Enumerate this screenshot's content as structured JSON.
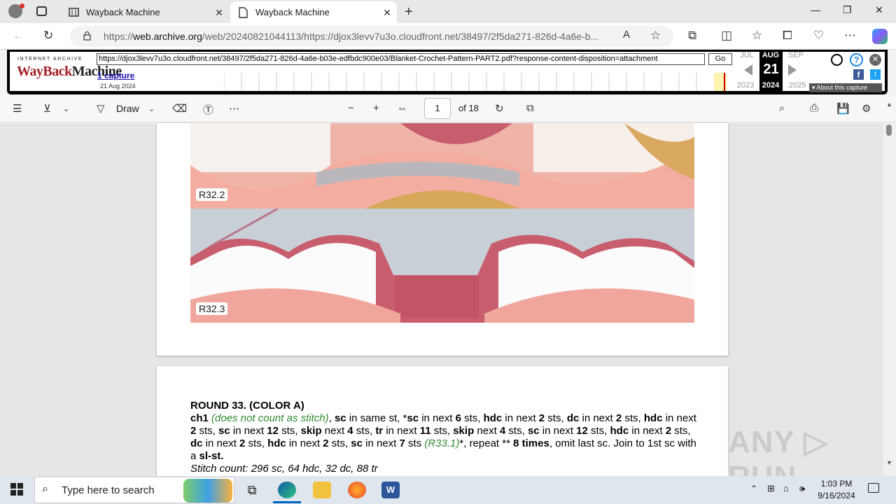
{
  "browser": {
    "tabs": [
      {
        "label": "Wayback Machine"
      },
      {
        "label": "Wayback Machine"
      }
    ],
    "url_prefix": "https://",
    "url_host": "web.archive.org",
    "url_rest": "/web/20240821044113/https://djox3levv7u3o.cloudfront.net/38497/2f5da271-826d-4a6e-b...",
    "new_tab_symbol": "+",
    "minimize_symbol": "—",
    "maximize_symbol": "❐",
    "close_symbol": "✕"
  },
  "wayback": {
    "logo_top": "INTERNET ARCHIVE",
    "logo_way": "Way",
    "logo_back": "Back",
    "logo_machine": "Machine",
    "url_field": "https://djox3levv7u3o.cloudfront.net/38497/2f5da271-826d-4a6e-b03e-edfbdc900e03/Blanket-Crochet-Pattern-PART2.pdf?response-content-disposition=attachment",
    "go_label": "Go",
    "captures_label": "1 capture",
    "capture_date": "21 Aug 2024",
    "prev_month": "JUL",
    "cur_month": "AUG",
    "next_month": "SEP",
    "day": "21",
    "prev_year": "2023",
    "cur_year": "2024",
    "next_year": "2025",
    "about_label": "About this capture"
  },
  "pdf_toolbar": {
    "draw_label": "Draw",
    "page_number": "1",
    "page_total": "of 18"
  },
  "document": {
    "photo1_label": "R32.2",
    "photo2_label": "R32.3",
    "round_heading": "ROUND 33. (COLOR A)",
    "line1_a": "ch1",
    "line1_b": "(does not count as stitch)",
    "line1_c": ", ",
    "p_sc": "sc",
    "t1": " in same st, *",
    "t2": " in next ",
    "n6": "6",
    "t3": " sts, ",
    "p_hdc": "hdc",
    "n2": "2",
    "p_dc": "dc",
    "n12": "12",
    "p_skip": "skip",
    "t_next": " next ",
    "n4": "4",
    "p_tr": "tr",
    "n11": "11",
    "n7": "7",
    "r331": "(R33.1)",
    "t_rep": "*, repeat ** ",
    "n8times": "8 times",
    "t_omit": ", omit last",
    "t_sc": "sc. Join to 1st sc with a ",
    "p_slst": "sl-st.",
    "stitch_count": "Stitch count: 296 sc, 64 hdc, 32 dc, 88 tr"
  },
  "watermark": "ANY ▷ RUN",
  "taskbar": {
    "search_placeholder": "Type here to search",
    "time": "1:03 PM",
    "date": "9/16/2024"
  }
}
